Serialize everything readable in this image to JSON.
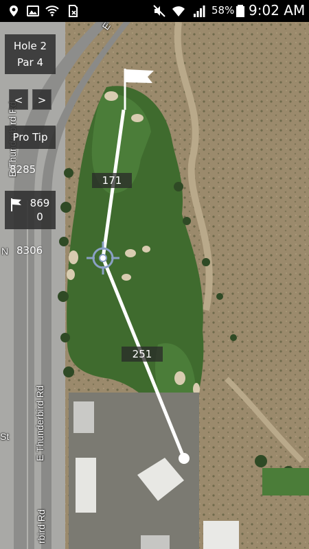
{
  "status_bar": {
    "icons": [
      "location-icon",
      "image-icon",
      "wifi-question-icon",
      "sim-icon",
      "mute-icon",
      "wifi-icon",
      "signal-icon",
      "battery-icon"
    ],
    "battery": "58%",
    "time": "9:02 AM"
  },
  "map": {
    "roads": [
      "E Thunderbird Rd",
      "E Thunderbird Rd",
      "rbird Rd",
      "E",
      "N",
      "St"
    ]
  },
  "hole": {
    "title": "Hole 2",
    "par": "Par 4"
  },
  "nav": {
    "prev": "<",
    "next": ">"
  },
  "pro_tip": "Pro Tip",
  "distances": {
    "front_left": "8285",
    "pin": "8690",
    "back_left": "8306",
    "to_green": "171",
    "from_tee": "251"
  },
  "colors": {
    "fairway": "#3f6b2e",
    "desert": "#9b8a6c",
    "overlay": "#2d2d2d",
    "line": "#ffffff"
  }
}
